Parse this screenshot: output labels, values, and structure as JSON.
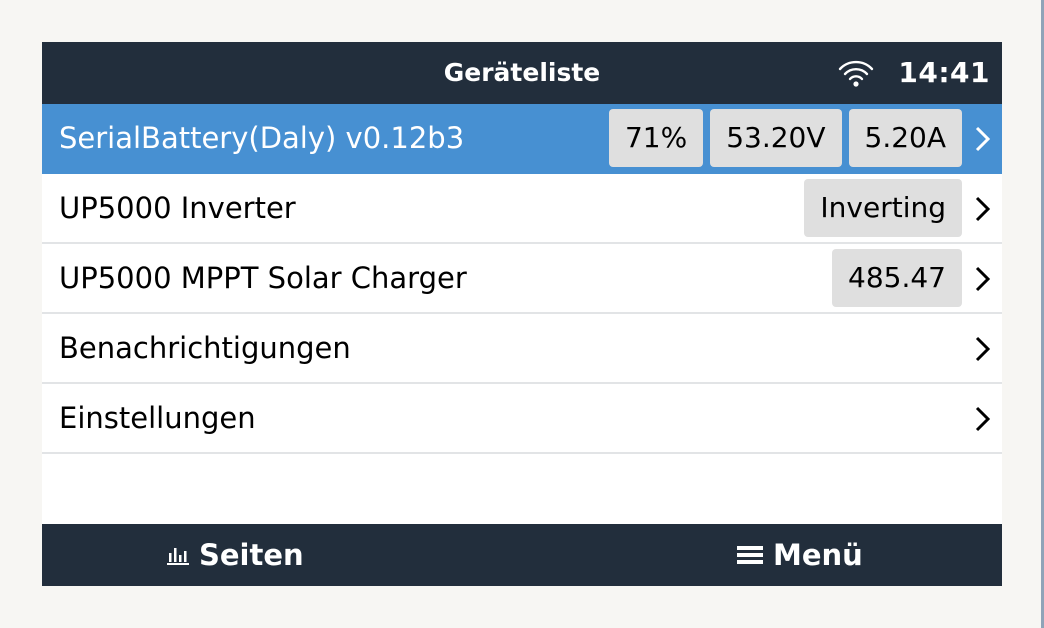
{
  "header": {
    "title": "Geräteliste",
    "time": "14:41",
    "status_icon": "wifi-icon"
  },
  "devices": [
    {
      "label": "SerialBattery(Daly) v0.12b3",
      "values": [
        "71%",
        "53.20V",
        "5.20A"
      ],
      "selected": true
    },
    {
      "label": "UP5000 Inverter",
      "values": [
        "Inverting"
      ]
    },
    {
      "label": "UP5000 MPPT Solar Charger",
      "values": [
        "485.47"
      ]
    },
    {
      "label": "Benachrichtigungen",
      "values": []
    },
    {
      "label": "Einstellungen",
      "values": []
    }
  ],
  "footer": {
    "pages_label": "Seiten",
    "pages_icon": "bar-chart-icon",
    "menu_label": "Menü",
    "menu_icon": "hamburger-menu-icon"
  },
  "colors": {
    "header_bg": "#222e3c",
    "selected_bg": "#4790d2",
    "pill_bg": "#dfdfdf",
    "page_bg": "#f7f6f3"
  }
}
